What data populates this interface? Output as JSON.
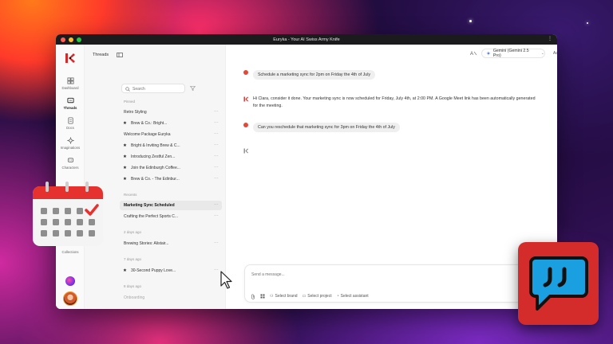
{
  "window": {
    "title": "Euryka - Your AI Swiss Army Knife"
  },
  "rail": {
    "items": [
      {
        "label": "Dashboard",
        "icon": "dashboard-icon"
      },
      {
        "label": "Threads",
        "icon": "chat-icon"
      },
      {
        "label": "Docs",
        "icon": "docs-icon"
      },
      {
        "label": "Imaginations",
        "icon": "sparkle-icon"
      },
      {
        "label": "Characters",
        "icon": "character-icon"
      },
      {
        "label": "Collections",
        "icon": "collections-icon"
      }
    ]
  },
  "threads": {
    "header": "Threads",
    "search_placeholder": "Search",
    "pinned_label": "Pinned",
    "pinned": [
      {
        "label": "Retro Styling",
        "starred": false
      },
      {
        "label": "Brew & Co.: Bright...",
        "starred": true
      },
      {
        "label": "Welcome Package Euryka",
        "starred": false
      },
      {
        "label": "Bright & Inviting Brew & C...",
        "starred": true
      },
      {
        "label": "Introducing Zestful Zen...",
        "starred": true
      },
      {
        "label": "Join the Edinburgh Coffee...",
        "starred": true
      },
      {
        "label": "Brew & Co. - The Edinbur...",
        "starred": true
      }
    ],
    "recents_label": "Recents",
    "recents": [
      {
        "label": "Marketing Sync Scheduled",
        "selected": true
      },
      {
        "label": "Crafting the Perfect Sports C...",
        "selected": false
      }
    ],
    "days_ago_label": "2 days ago",
    "days_ago": [
      {
        "label": "Brewing Stories: Alistair...",
        "starred": false
      }
    ],
    "week_label": "7 days ago",
    "week": [
      {
        "label": "30-Second Puppy Love...",
        "starred": true
      }
    ],
    "older_label": "8 days ago",
    "older": [
      {
        "label": "Onboarding",
        "starred": false
      }
    ],
    "more_glyph": "···"
  },
  "main": {
    "model": "Gemini (Gemini 2.5 Pro)",
    "font_size_label": "Aa",
    "messages": [
      {
        "role": "user",
        "text": "Schedule a marketing sync for 2pm on Friday the 4th of July"
      },
      {
        "role": "assistant",
        "text": "Hi Clara, consider it done. Your marketing sync is now scheduled for Friday, July 4th, at 2:00 PM. A Google Meet link has been automatically generated for the meeting."
      },
      {
        "role": "user",
        "text": "Can you reschedule that marketing sync for 3pm on Friday the 4th of July"
      }
    ],
    "composer": {
      "placeholder": "Send a message...",
      "brand": "Select brand",
      "project": "Select project",
      "assistant": "Select assistant"
    }
  },
  "colors": {
    "brand_red": "#d42b2b",
    "bubble_blue": "#1aa0e0",
    "calendar_red": "#e5322f"
  }
}
